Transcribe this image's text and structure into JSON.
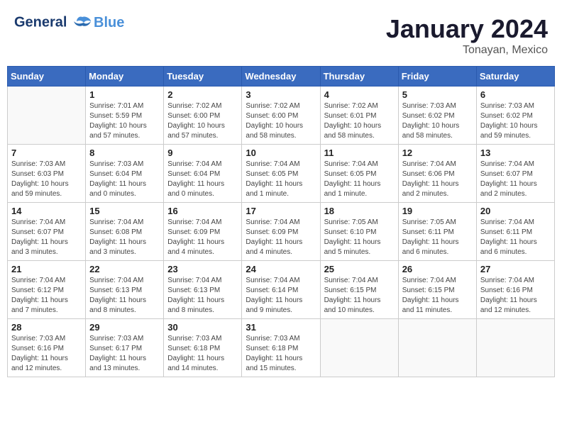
{
  "header": {
    "logo_line1": "General",
    "logo_line2": "Blue",
    "month": "January 2024",
    "location": "Tonayan, Mexico"
  },
  "weekdays": [
    "Sunday",
    "Monday",
    "Tuesday",
    "Wednesday",
    "Thursday",
    "Friday",
    "Saturday"
  ],
  "weeks": [
    [
      {
        "day": "",
        "info": ""
      },
      {
        "day": "1",
        "info": "Sunrise: 7:01 AM\nSunset: 5:59 PM\nDaylight: 10 hours\nand 57 minutes."
      },
      {
        "day": "2",
        "info": "Sunrise: 7:02 AM\nSunset: 6:00 PM\nDaylight: 10 hours\nand 57 minutes."
      },
      {
        "day": "3",
        "info": "Sunrise: 7:02 AM\nSunset: 6:00 PM\nDaylight: 10 hours\nand 58 minutes."
      },
      {
        "day": "4",
        "info": "Sunrise: 7:02 AM\nSunset: 6:01 PM\nDaylight: 10 hours\nand 58 minutes."
      },
      {
        "day": "5",
        "info": "Sunrise: 7:03 AM\nSunset: 6:02 PM\nDaylight: 10 hours\nand 58 minutes."
      },
      {
        "day": "6",
        "info": "Sunrise: 7:03 AM\nSunset: 6:02 PM\nDaylight: 10 hours\nand 59 minutes."
      }
    ],
    [
      {
        "day": "7",
        "info": "Sunrise: 7:03 AM\nSunset: 6:03 PM\nDaylight: 10 hours\nand 59 minutes."
      },
      {
        "day": "8",
        "info": "Sunrise: 7:03 AM\nSunset: 6:04 PM\nDaylight: 11 hours\nand 0 minutes."
      },
      {
        "day": "9",
        "info": "Sunrise: 7:04 AM\nSunset: 6:04 PM\nDaylight: 11 hours\nand 0 minutes."
      },
      {
        "day": "10",
        "info": "Sunrise: 7:04 AM\nSunset: 6:05 PM\nDaylight: 11 hours\nand 1 minute."
      },
      {
        "day": "11",
        "info": "Sunrise: 7:04 AM\nSunset: 6:05 PM\nDaylight: 11 hours\nand 1 minute."
      },
      {
        "day": "12",
        "info": "Sunrise: 7:04 AM\nSunset: 6:06 PM\nDaylight: 11 hours\nand 2 minutes."
      },
      {
        "day": "13",
        "info": "Sunrise: 7:04 AM\nSunset: 6:07 PM\nDaylight: 11 hours\nand 2 minutes."
      }
    ],
    [
      {
        "day": "14",
        "info": "Sunrise: 7:04 AM\nSunset: 6:07 PM\nDaylight: 11 hours\nand 3 minutes."
      },
      {
        "day": "15",
        "info": "Sunrise: 7:04 AM\nSunset: 6:08 PM\nDaylight: 11 hours\nand 3 minutes."
      },
      {
        "day": "16",
        "info": "Sunrise: 7:04 AM\nSunset: 6:09 PM\nDaylight: 11 hours\nand 4 minutes."
      },
      {
        "day": "17",
        "info": "Sunrise: 7:04 AM\nSunset: 6:09 PM\nDaylight: 11 hours\nand 4 minutes."
      },
      {
        "day": "18",
        "info": "Sunrise: 7:05 AM\nSunset: 6:10 PM\nDaylight: 11 hours\nand 5 minutes."
      },
      {
        "day": "19",
        "info": "Sunrise: 7:05 AM\nSunset: 6:11 PM\nDaylight: 11 hours\nand 6 minutes."
      },
      {
        "day": "20",
        "info": "Sunrise: 7:04 AM\nSunset: 6:11 PM\nDaylight: 11 hours\nand 6 minutes."
      }
    ],
    [
      {
        "day": "21",
        "info": "Sunrise: 7:04 AM\nSunset: 6:12 PM\nDaylight: 11 hours\nand 7 minutes."
      },
      {
        "day": "22",
        "info": "Sunrise: 7:04 AM\nSunset: 6:13 PM\nDaylight: 11 hours\nand 8 minutes."
      },
      {
        "day": "23",
        "info": "Sunrise: 7:04 AM\nSunset: 6:13 PM\nDaylight: 11 hours\nand 8 minutes."
      },
      {
        "day": "24",
        "info": "Sunrise: 7:04 AM\nSunset: 6:14 PM\nDaylight: 11 hours\nand 9 minutes."
      },
      {
        "day": "25",
        "info": "Sunrise: 7:04 AM\nSunset: 6:15 PM\nDaylight: 11 hours\nand 10 minutes."
      },
      {
        "day": "26",
        "info": "Sunrise: 7:04 AM\nSunset: 6:15 PM\nDaylight: 11 hours\nand 11 minutes."
      },
      {
        "day": "27",
        "info": "Sunrise: 7:04 AM\nSunset: 6:16 PM\nDaylight: 11 hours\nand 12 minutes."
      }
    ],
    [
      {
        "day": "28",
        "info": "Sunrise: 7:03 AM\nSunset: 6:16 PM\nDaylight: 11 hours\nand 12 minutes."
      },
      {
        "day": "29",
        "info": "Sunrise: 7:03 AM\nSunset: 6:17 PM\nDaylight: 11 hours\nand 13 minutes."
      },
      {
        "day": "30",
        "info": "Sunrise: 7:03 AM\nSunset: 6:18 PM\nDaylight: 11 hours\nand 14 minutes."
      },
      {
        "day": "31",
        "info": "Sunrise: 7:03 AM\nSunset: 6:18 PM\nDaylight: 11 hours\nand 15 minutes."
      },
      {
        "day": "",
        "info": ""
      },
      {
        "day": "",
        "info": ""
      },
      {
        "day": "",
        "info": ""
      }
    ]
  ]
}
